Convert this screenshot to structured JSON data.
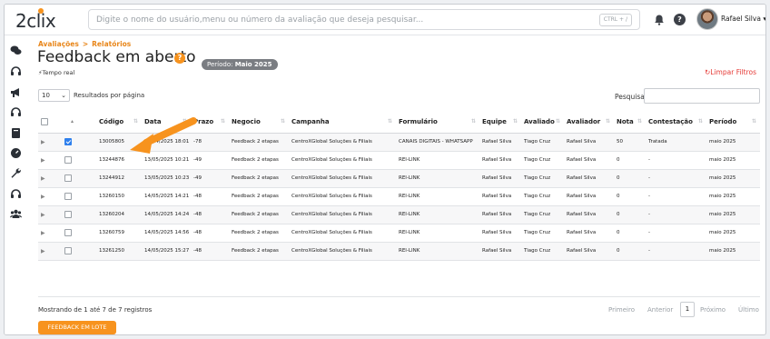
{
  "app": {
    "logo": "2clix",
    "user_name": "Rafael Silva"
  },
  "search": {
    "placeholder": "Digite o nome do usuário,menu ou número da avaliação que deseja pesquisar...",
    "shortcut": "CTRL + /"
  },
  "breadcrumb": {
    "parent": "Avaliações",
    "separator": ">",
    "current": "Relatórios"
  },
  "page": {
    "title": "Feedback em aberto",
    "period_label": "Período",
    "period_value": "Maio 2025",
    "realtime": "Tempo real",
    "clear_filters": "Limpar Filtros"
  },
  "table_controls": {
    "per_page_value": "10",
    "per_page_label": "Resultados por página",
    "search_label": "Pesquisar"
  },
  "columns": [
    "Código",
    "Data",
    "Prazo",
    "Negocio",
    "Campanha",
    "Formulário",
    "Equipe",
    "Avaliado",
    "Avaliador",
    "Nota",
    "Contestação",
    "Período"
  ],
  "rows": [
    {
      "checked": true,
      "codigo": "13005805",
      "data": "13/04/2025 18:01",
      "prazo": "-78",
      "negocio": "Feedback 2 etapas",
      "campanha": "CentroXGlobal Soluções & Filiais",
      "formulario": "CANAIS DIGITAIS - WHATSAPP",
      "equipe": "Rafael Silva",
      "avaliado": "Tiago Cruz",
      "avaliador": "Rafael Silva",
      "nota": "50",
      "contestacao": "Tratada",
      "periodo": "maio 2025"
    },
    {
      "checked": false,
      "codigo": "13244876",
      "data": "13/05/2025 10:21",
      "prazo": "-49",
      "negocio": "Feedback 2 etapas",
      "campanha": "CentroXGlobal Soluções & Filiais",
      "formulario": "REI-LINK",
      "equipe": "Rafael Silva",
      "avaliado": "Tiago Cruz",
      "avaliador": "Rafael Silva",
      "nota": "0",
      "contestacao": "-",
      "periodo": "maio 2025"
    },
    {
      "checked": false,
      "codigo": "13244912",
      "data": "13/05/2025 10:23",
      "prazo": "-49",
      "negocio": "Feedback 2 etapas",
      "campanha": "CentroXGlobal Soluções & Filiais",
      "formulario": "REI-LINK",
      "equipe": "Rafael Silva",
      "avaliado": "Tiago Cruz",
      "avaliador": "Rafael Silva",
      "nota": "0",
      "contestacao": "-",
      "periodo": "maio 2025"
    },
    {
      "checked": false,
      "codigo": "13260150",
      "data": "14/05/2025 14:21",
      "prazo": "-48",
      "negocio": "Feedback 2 etapas",
      "campanha": "CentroXGlobal Soluções & Filiais",
      "formulario": "REI-LINK",
      "equipe": "Rafael Silva",
      "avaliado": "Tiago Cruz",
      "avaliador": "Rafael Silva",
      "nota": "0",
      "contestacao": "-",
      "periodo": "maio 2025"
    },
    {
      "checked": false,
      "codigo": "13260204",
      "data": "14/05/2025 14:24",
      "prazo": "-48",
      "negocio": "Feedback 2 etapas",
      "campanha": "CentroXGlobal Soluções & Filiais",
      "formulario": "REI-LINK",
      "equipe": "Rafael Silva",
      "avaliado": "Tiago Cruz",
      "avaliador": "Rafael Silva",
      "nota": "0",
      "contestacao": "-",
      "periodo": "maio 2025"
    },
    {
      "checked": false,
      "codigo": "13260759",
      "data": "14/05/2025 14:56",
      "prazo": "-48",
      "negocio": "Feedback 2 etapas",
      "campanha": "CentroXGlobal Soluções & Filiais",
      "formulario": "REI-LINK",
      "equipe": "Rafael Silva",
      "avaliado": "Tiago Cruz",
      "avaliador": "Rafael Silva",
      "nota": "0",
      "contestacao": "-",
      "periodo": "maio 2025"
    },
    {
      "checked": false,
      "codigo": "13261250",
      "data": "14/05/2025 15:27",
      "prazo": "-48",
      "negocio": "Feedback 2 etapas",
      "campanha": "CentroXGlobal Soluções & Filiais",
      "formulario": "REI-LINK",
      "equipe": "Rafael Silva",
      "avaliado": "Tiago Cruz",
      "avaliador": "Rafael Silva",
      "nota": "0",
      "contestacao": "-",
      "periodo": "maio 2025"
    }
  ],
  "footer": {
    "showing": "Mostrando de 1 até 7 de 7 registros",
    "first": "Primeiro",
    "prev": "Anterior",
    "current_page": "1",
    "next": "Próximo",
    "last": "Último",
    "batch_button": "FEEDBACK EM LOTE"
  },
  "colors": {
    "accent": "#f7931e",
    "danger": "#e53935",
    "checkbox": "#2f80ed"
  }
}
